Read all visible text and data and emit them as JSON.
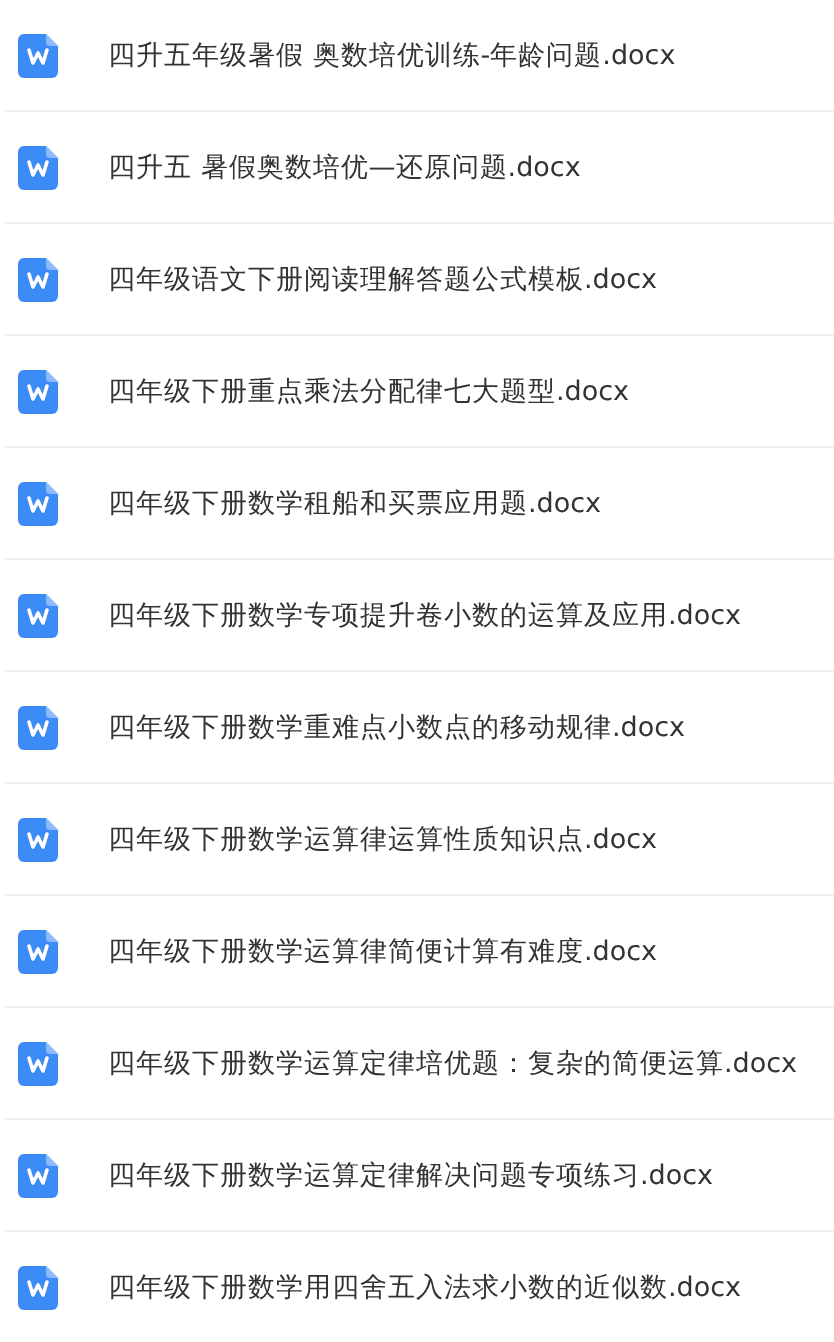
{
  "files": [
    {
      "name": "四升五年级暑假 奥数培优训练-年龄问题.docx"
    },
    {
      "name": "四升五 暑假奥数培优—还原问题.docx"
    },
    {
      "name": "四年级语文下册阅读理解答题公式模板.docx"
    },
    {
      "name": "四年级下册重点乘法分配律七大题型.docx"
    },
    {
      "name": "四年级下册数学租船和买票应用题.docx"
    },
    {
      "name": "四年级下册数学专项提升卷小数的运算及应用.docx"
    },
    {
      "name": "四年级下册数学重难点小数点的移动规律.docx"
    },
    {
      "name": "四年级下册数学运算律运算性质知识点.docx"
    },
    {
      "name": "四年级下册数学运算律简便计算有难度.docx"
    },
    {
      "name": "四年级下册数学运算定律培优题：复杂的简便运算.docx"
    },
    {
      "name": "四年级下册数学运算定律解决问题专项练习.docx"
    },
    {
      "name": "四年级下册数学用四舍五入法求小数的近似数.docx"
    }
  ]
}
